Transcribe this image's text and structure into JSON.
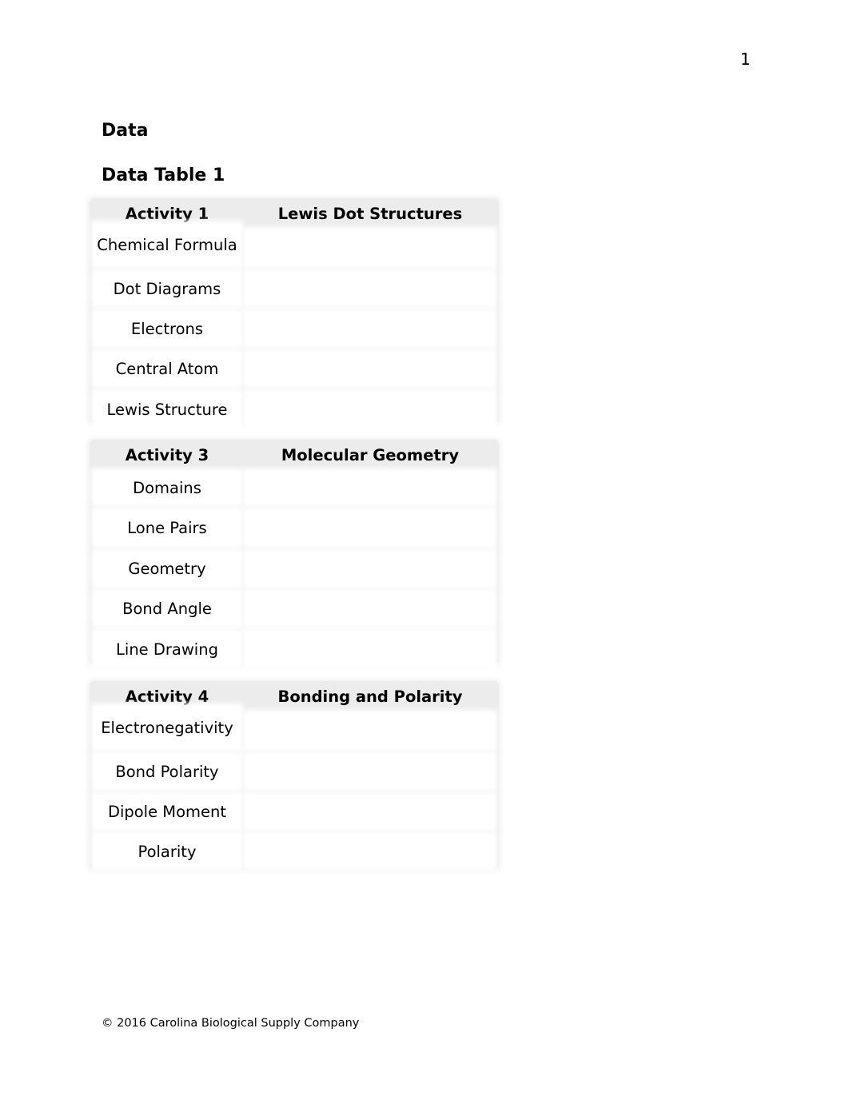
{
  "page": {
    "number": "1",
    "section_heading": "Data",
    "table_heading": "Data Table 1",
    "footer": "© 2016 Carolina Biological Supply Company"
  },
  "tables": [
    {
      "header": [
        "Activity 1",
        "Lewis Dot Structures"
      ],
      "rows": [
        {
          "label": "Chemical Formula",
          "value": ""
        },
        {
          "label": "Dot Diagrams",
          "value": ""
        },
        {
          "label": "Electrons",
          "value": ""
        },
        {
          "label": "Central Atom",
          "value": ""
        },
        {
          "label": "Lewis Structure",
          "value": ""
        }
      ]
    },
    {
      "header": [
        "Activity 3",
        "Molecular Geometry"
      ],
      "rows": [
        {
          "label": "Domains",
          "value": ""
        },
        {
          "label": "Lone Pairs",
          "value": ""
        },
        {
          "label": "Geometry",
          "value": ""
        },
        {
          "label": "Bond Angle",
          "value": ""
        },
        {
          "label": "Line Drawing",
          "value": ""
        }
      ]
    },
    {
      "header": [
        "Activity 4",
        "Bonding and Polarity"
      ],
      "rows": [
        {
          "label": "Electronegativity",
          "value": ""
        },
        {
          "label": "Bond Polarity",
          "value": ""
        },
        {
          "label": "Dipole Moment",
          "value": ""
        },
        {
          "label": "Polarity",
          "value": ""
        }
      ]
    }
  ]
}
